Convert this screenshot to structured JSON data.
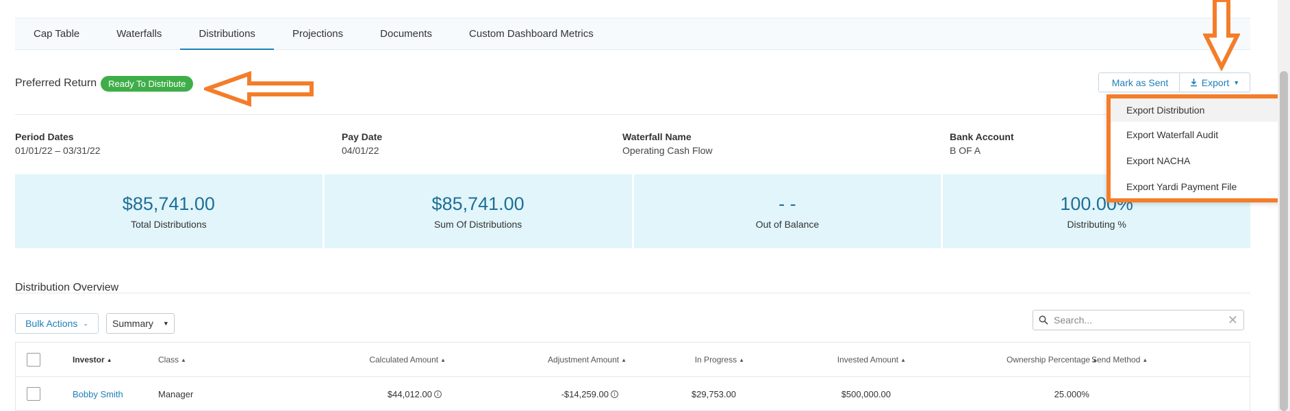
{
  "tabs": [
    "Cap Table",
    "Waterfalls",
    "Distributions",
    "Projections",
    "Documents",
    "Custom Dashboard Metrics"
  ],
  "header": {
    "title": "Preferred Return",
    "status": "Ready To Distribute"
  },
  "actions": {
    "mark_sent": "Mark as Sent",
    "export": "Export"
  },
  "export_menu": [
    "Export Distribution",
    "Export Waterfall Audit",
    "Export NACHA",
    "Export Yardi Payment File"
  ],
  "meta": [
    {
      "label": "Period Dates",
      "value": "01/01/22 – 03/31/22"
    },
    {
      "label": "Pay Date",
      "value": "04/01/22"
    },
    {
      "label": "Waterfall Name",
      "value": "Operating Cash Flow"
    },
    {
      "label": "Bank Account",
      "value": "B OF A"
    }
  ],
  "stats": [
    {
      "value": "$85,741.00",
      "label": "Total Distributions"
    },
    {
      "value": "$85,741.00",
      "label": "Sum Of Distributions"
    },
    {
      "value": "- -",
      "label": "Out of Balance"
    },
    {
      "value": "100.00%",
      "label": "Distributing %"
    }
  ],
  "overview": {
    "title": "Distribution Overview",
    "bulk_actions": "Bulk Actions",
    "summary": "Summary",
    "search_placeholder": "Search...",
    "columns": [
      "Investor",
      "Class",
      "Calculated Amount",
      "Adjustment Amount",
      "In Progress",
      "Invested Amount",
      "Ownership Percentage",
      "Send Method"
    ],
    "rows": [
      {
        "investor": "Bobby Smith",
        "class": "Manager",
        "calculated": "$44,012.00",
        "adjustment": "-$14,259.00",
        "in_progress": "$29,753.00",
        "invested": "$500,000.00",
        "ownership": "25.000%",
        "send_method": ""
      }
    ]
  },
  "colors": {
    "accent": "#1c7fb8",
    "status_green": "#3fae49",
    "highlight_orange": "#f47d2a",
    "stat_bg": "#e1f5fb"
  }
}
